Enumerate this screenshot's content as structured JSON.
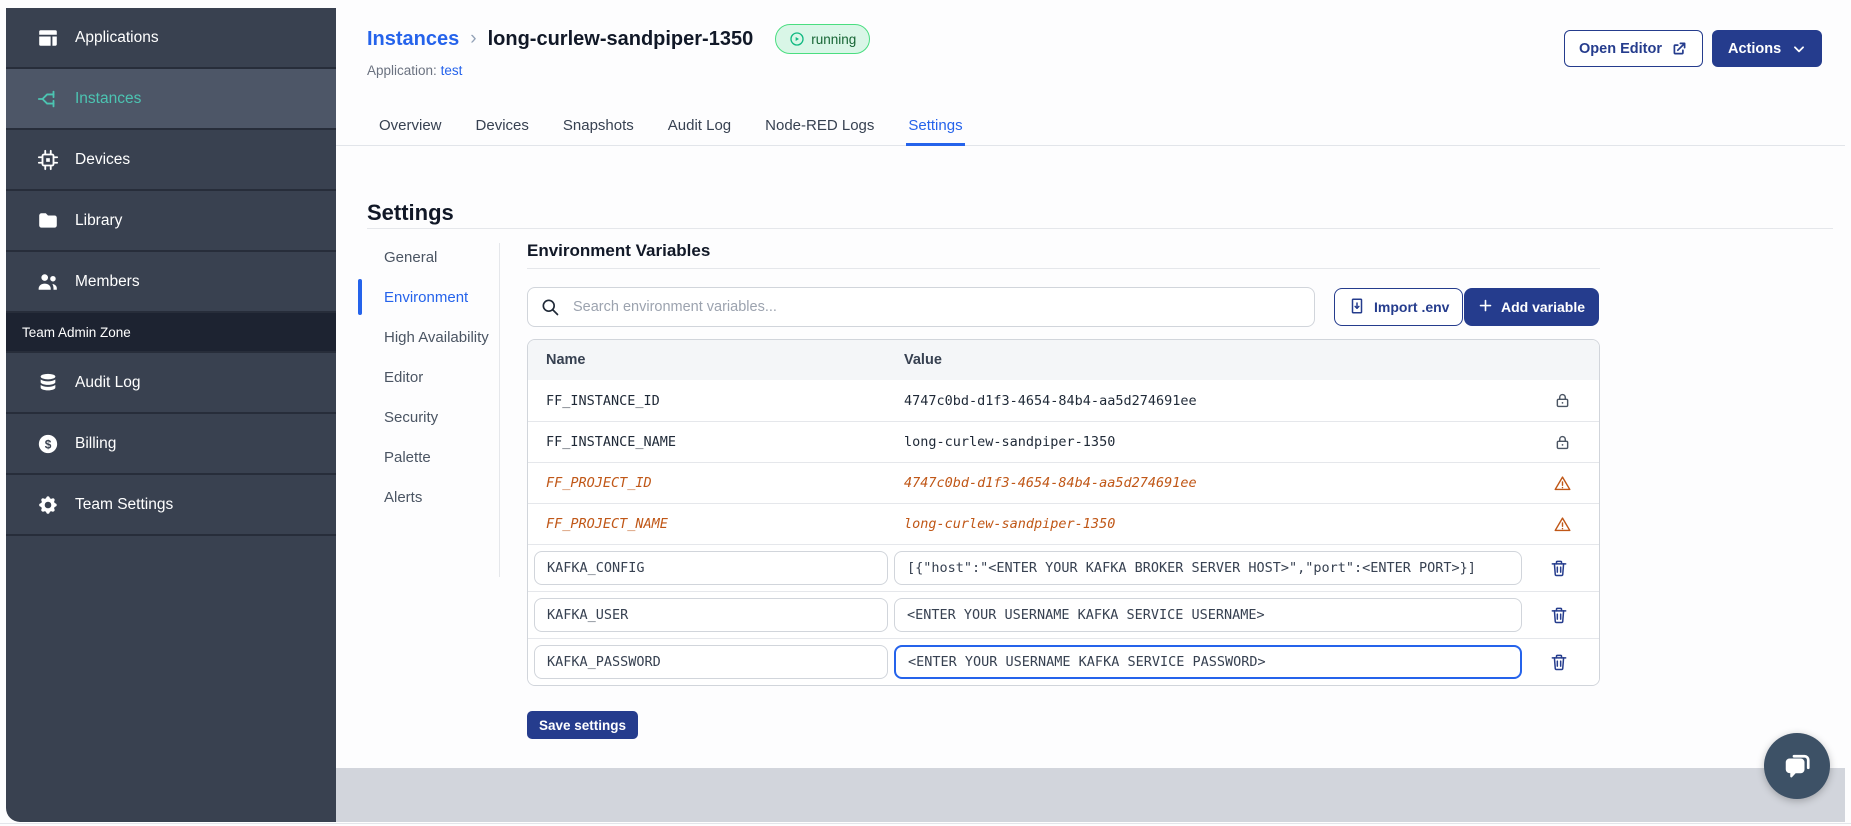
{
  "sidebar": {
    "items": [
      {
        "label": "Applications"
      },
      {
        "label": "Instances"
      },
      {
        "label": "Devices"
      },
      {
        "label": "Library"
      },
      {
        "label": "Members"
      }
    ],
    "section_label": "Team Admin Zone",
    "admin_items": [
      {
        "label": "Audit Log"
      },
      {
        "label": "Billing"
      },
      {
        "label": "Team Settings"
      }
    ]
  },
  "header": {
    "breadcrumb_root": "Instances",
    "breadcrumb_separator": "›",
    "instance_name": "long-curlew-sandpiper-1350",
    "status_badge": "running",
    "application_label": "Application:",
    "application_name": "test",
    "open_editor_label": "Open Editor",
    "actions_label": "Actions"
  },
  "tabs": {
    "items": [
      "Overview",
      "Devices",
      "Snapshots",
      "Audit Log",
      "Node-RED Logs",
      "Settings"
    ],
    "active": "Settings"
  },
  "settings": {
    "title": "Settings",
    "nav": [
      "General",
      "Environment",
      "High Availability",
      "Editor",
      "Security",
      "Palette",
      "Alerts"
    ],
    "active_nav": "Environment"
  },
  "env": {
    "title": "Environment Variables",
    "search_placeholder": "Search environment variables...",
    "import_label": "Import .env",
    "add_label": "Add variable",
    "save_label": "Save settings",
    "columns": {
      "name": "Name",
      "value": "Value"
    },
    "rows": [
      {
        "name": "FF_INSTANCE_ID",
        "value": "4747c0bd-d1f3-4654-84b4-aa5d274691ee",
        "type": "locked"
      },
      {
        "name": "FF_INSTANCE_NAME",
        "value": "long-curlew-sandpiper-1350",
        "type": "locked"
      },
      {
        "name": "FF_PROJECT_ID",
        "value": "4747c0bd-d1f3-4654-84b4-aa5d274691ee",
        "type": "deprecated"
      },
      {
        "name": "FF_PROJECT_NAME",
        "value": "long-curlew-sandpiper-1350",
        "type": "deprecated"
      },
      {
        "name": "KAFKA_CONFIG",
        "value": "[{\"host\":\"<ENTER YOUR KAFKA BROKER SERVER HOST>\",\"port\":<ENTER PORT>}]",
        "type": "editable"
      },
      {
        "name": "KAFKA_USER",
        "value": "<ENTER YOUR USERNAME KAFKA SERVICE USERNAME>",
        "type": "editable"
      },
      {
        "name": "KAFKA_PASSWORD",
        "value": "<ENTER YOUR USERNAME KAFKA SERVICE PASSWORD>",
        "type": "editable",
        "focused": true
      }
    ]
  },
  "colors": {
    "sidebar_bg": "#394150",
    "sidebar_active_bg": "#4d5667",
    "teal_accent": "#4cc4b2",
    "link_blue": "#2563eb",
    "navy_button": "#253c8d",
    "warning_orange": "#c05717",
    "running_green": "#10b981",
    "footer_gray": "#d2d5dc"
  }
}
